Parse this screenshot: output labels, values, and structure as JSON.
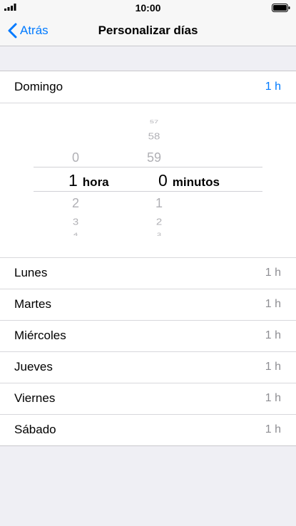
{
  "status_bar": {
    "time": "10:00"
  },
  "nav": {
    "back_label": "Atrás",
    "title": "Personalizar días"
  },
  "picker": {
    "hours_above": [
      "0"
    ],
    "hours_selected": "1",
    "hours_unit": "hora",
    "hours_below": [
      "2",
      "3",
      "4"
    ],
    "minutes_above": [
      "57",
      "58",
      "59"
    ],
    "minutes_selected": "0",
    "minutes_unit": "minutos",
    "minutes_below": [
      "1",
      "2",
      "3"
    ]
  },
  "days": [
    {
      "name": "Domingo",
      "value": "1 h"
    },
    {
      "name": "Lunes",
      "value": "1 h"
    },
    {
      "name": "Martes",
      "value": "1 h"
    },
    {
      "name": "Miércoles",
      "value": "1 h"
    },
    {
      "name": "Jueves",
      "value": "1 h"
    },
    {
      "name": "Viernes",
      "value": "1 h"
    },
    {
      "name": "Sábado",
      "value": "1 h"
    }
  ],
  "colors": {
    "accent": "#007aff",
    "secondary_text": "#8e8e93",
    "background": "#efeff4"
  }
}
